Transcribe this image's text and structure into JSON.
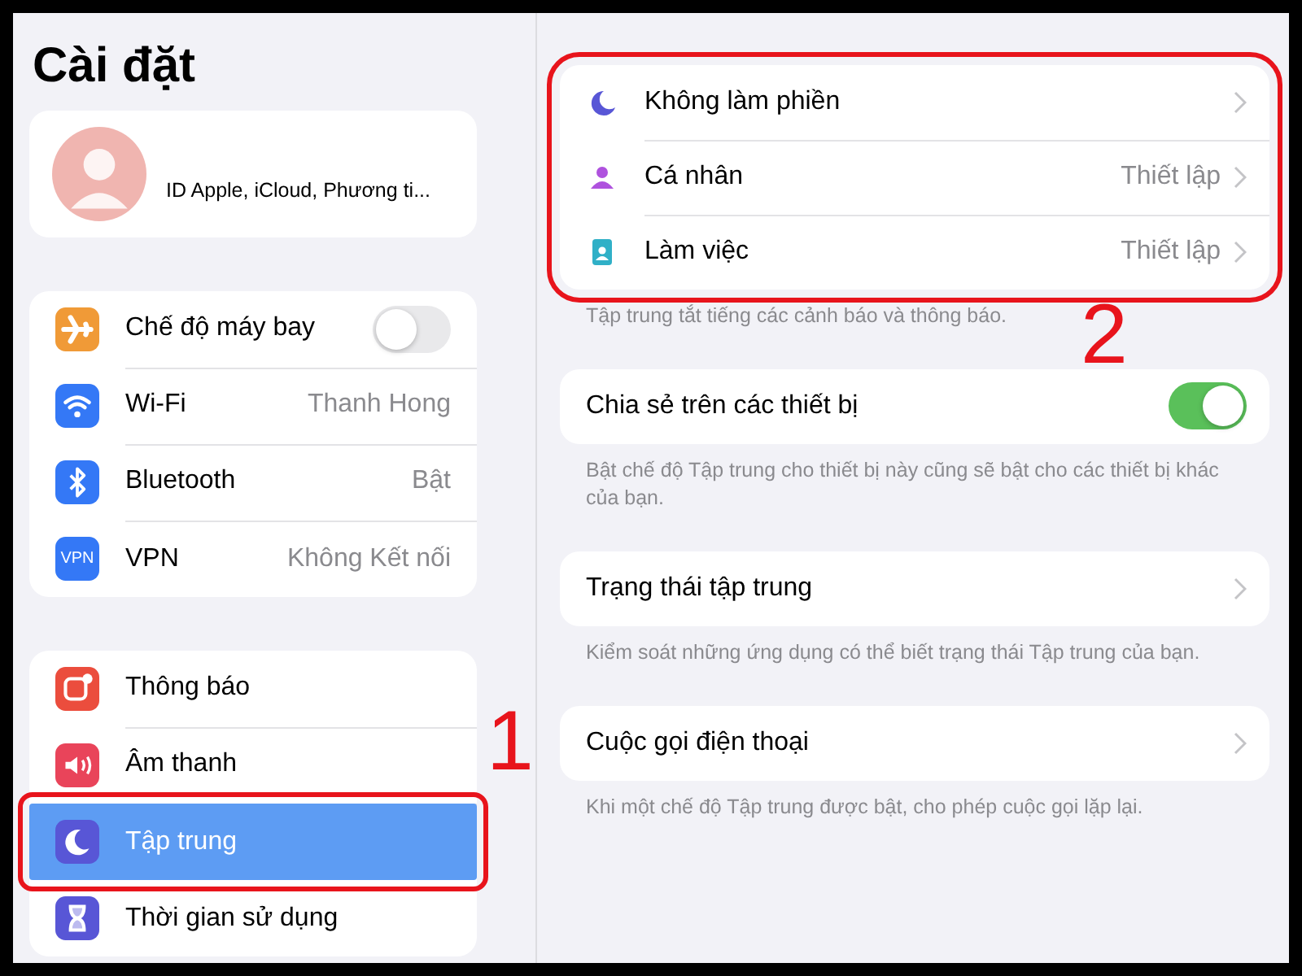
{
  "sidebar": {
    "title": "Cài đặt",
    "profile": {
      "subtitle": "ID Apple, iCloud, Phương ti..."
    },
    "groups": [
      [
        {
          "label": "Chế độ máy bay",
          "kind": "toggle",
          "on": false,
          "color": "#f09a37",
          "selected": false
        },
        {
          "label": "Wi-Fi",
          "kind": "value",
          "value": "Thanh Hong",
          "color": "#3478f6",
          "selected": false
        },
        {
          "label": "Bluetooth",
          "kind": "value",
          "value": "Bật",
          "color": "#3478f6",
          "selected": false
        },
        {
          "label": "VPN",
          "kind": "value",
          "value": "Không Kết nối",
          "color": "#3478f6",
          "icon_text": "VPN",
          "selected": false
        }
      ],
      [
        {
          "label": "Thông báo",
          "kind": "plain",
          "color": "#eb4d3d",
          "selected": false
        },
        {
          "label": "Âm thanh",
          "kind": "plain",
          "color": "#e9445a",
          "selected": false
        },
        {
          "label": "Tập trung",
          "kind": "plain",
          "color": "#5856d6",
          "selected": true
        },
        {
          "label": "Thời gian sử dụng",
          "kind": "plain",
          "color": "#5856d6",
          "selected": false
        }
      ]
    ]
  },
  "detail": {
    "sections": [
      {
        "rows": [
          {
            "label": "Không làm phiền",
            "kind": "link",
            "color": "#5856d6"
          },
          {
            "label": "Cá nhân",
            "kind": "link",
            "value": "Thiết lập",
            "color": "#af52de"
          },
          {
            "label": "Làm việc",
            "kind": "link",
            "value": "Thiết lập",
            "color": "#30b0c7"
          }
        ],
        "footer": "Tập trung tắt tiếng các cảnh báo và thông báo.",
        "highlighted": true
      },
      {
        "rows": [
          {
            "label": "Chia sẻ trên các thiết bị",
            "kind": "toggle",
            "on": true
          }
        ],
        "footer": "Bật chế độ Tập trung cho thiết bị này cũng sẽ bật cho các thiết bị khác của bạn.",
        "highlighted": false
      },
      {
        "rows": [
          {
            "label": "Trạng thái tập trung",
            "kind": "link"
          }
        ],
        "footer": "Kiểm soát những ứng dụng có thể biết trạng thái Tập trung của bạn.",
        "highlighted": false
      },
      {
        "rows": [
          {
            "label": "Cuộc gọi điện thoại",
            "kind": "link"
          }
        ],
        "footer": "Khi một chế độ Tập trung được bật, cho phép cuộc gọi lặp lại.",
        "highlighted": false
      }
    ]
  },
  "annotations": [
    {
      "label": "1"
    },
    {
      "label": "2"
    }
  ]
}
